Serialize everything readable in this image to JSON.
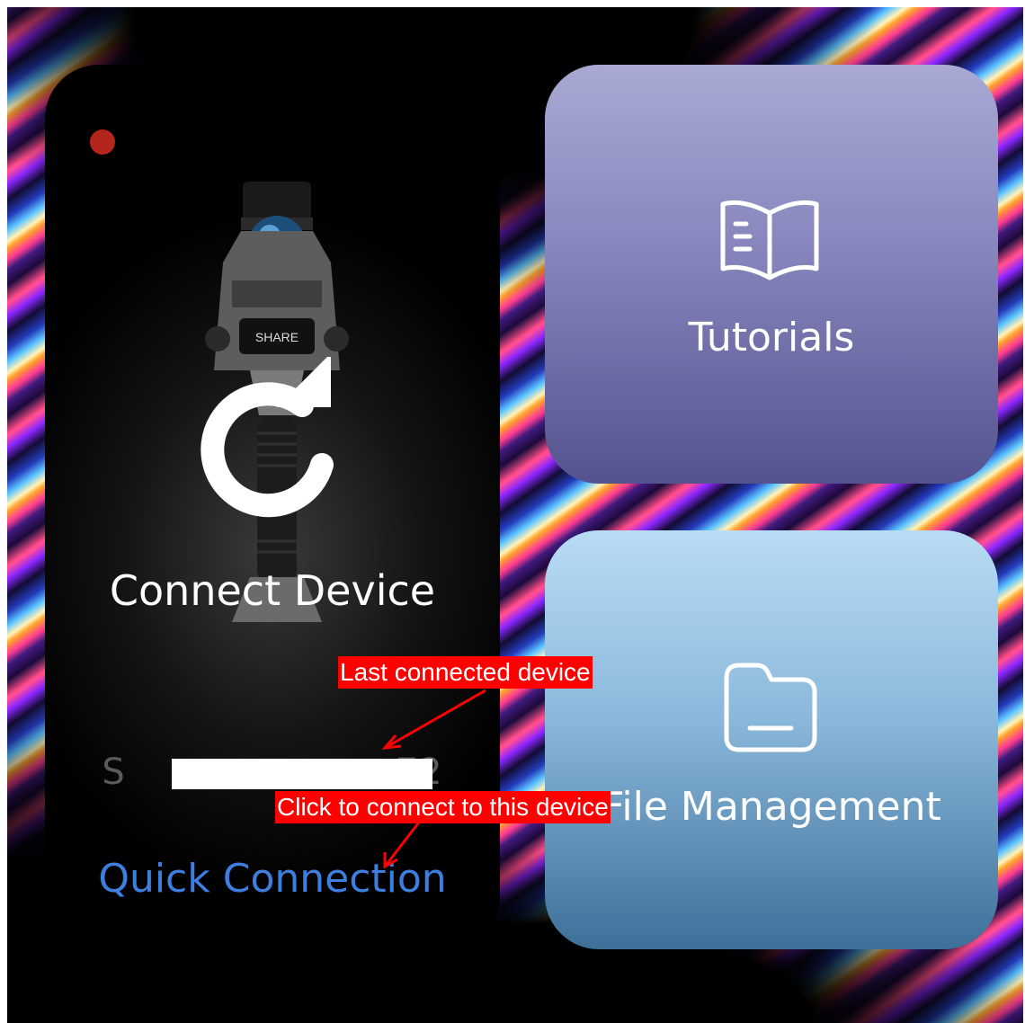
{
  "cards": {
    "connect": {
      "title": "Connect Device",
      "serial_prefix": "S",
      "serial_suffix": "72",
      "quick_connection": "Quick Connection",
      "device_brand": "SHARE"
    },
    "tutorials": {
      "label": "Tutorials"
    },
    "file_management": {
      "label": "File Management"
    }
  },
  "annotations": {
    "last_connected": "Last connected device",
    "click_to_connect": "Click to connect to this device"
  },
  "colors": {
    "accent_blue": "#3d7fe0",
    "record_red": "#b4251c",
    "annotation_red": "#ff0000"
  },
  "icons": [
    "refresh-icon",
    "book-icon",
    "folder-icon",
    "record-indicator"
  ]
}
